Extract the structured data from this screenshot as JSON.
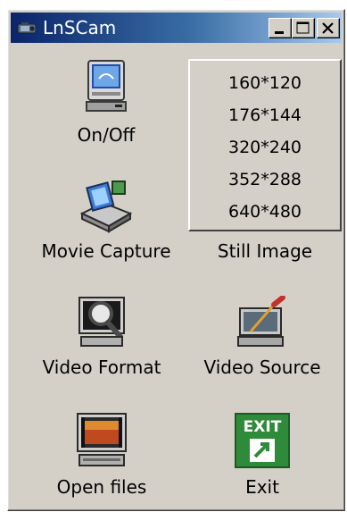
{
  "window": {
    "title": "LnSCam"
  },
  "titlebar": {
    "icon": "camera-icon",
    "buttons": [
      "minimize",
      "maximize",
      "close"
    ]
  },
  "tiles": {
    "onoff": {
      "label": "On/Off",
      "icon": "monitor-power-icon"
    },
    "movie_capture": {
      "label": "Movie Capture",
      "icon": "film-camera-icon"
    },
    "still_image": {
      "label": "Still Image",
      "resolutions": [
        "160*120",
        "176*144",
        "320*240",
        "352*288",
        "640*480"
      ]
    },
    "video_format": {
      "label": "Video Format",
      "icon": "magnifier-monitor-icon"
    },
    "video_source": {
      "label": "Video Source",
      "icon": "screwdriver-monitor-icon"
    },
    "open_files": {
      "label": "Open files",
      "icon": "film-monitor-icon"
    },
    "exit": {
      "label": "Exit",
      "icon": "exit-sign-icon",
      "icon_text": "EXIT"
    }
  },
  "colors": {
    "titlebar_start": "#0a246a",
    "titlebar_end": "#a6caf0",
    "face": "#d4d0c8",
    "exit_green": "#2e8b3a"
  }
}
